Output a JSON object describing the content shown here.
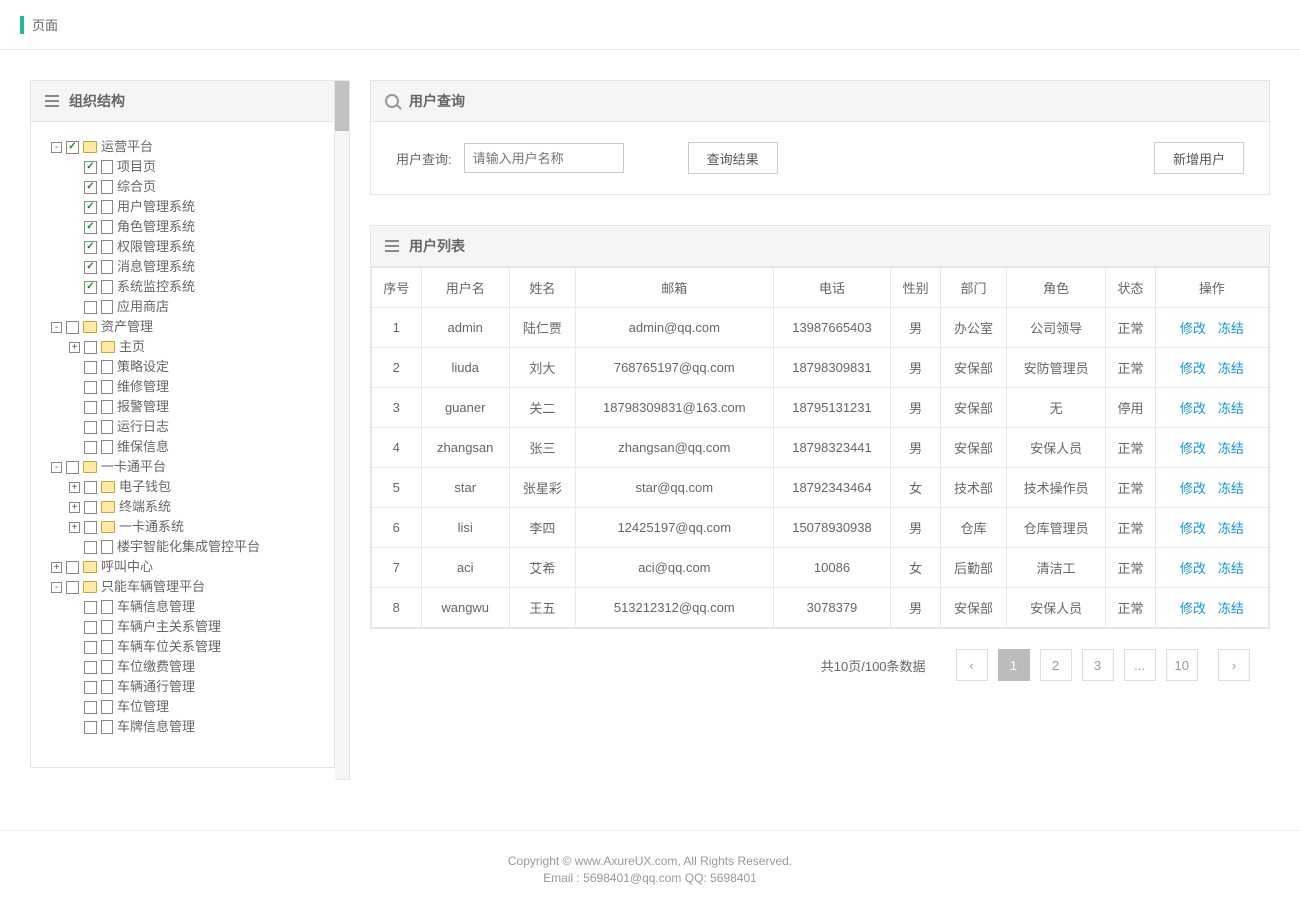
{
  "topbar": {
    "title": "页面"
  },
  "left": {
    "header": "组织结构",
    "tree": [
      {
        "label": "运营平台",
        "type": "folder",
        "toggle": "-",
        "checked": true,
        "children": [
          {
            "label": "项目页",
            "type": "page",
            "checked": true
          },
          {
            "label": "综合页",
            "type": "page",
            "checked": true
          },
          {
            "label": "用户管理系统",
            "type": "page",
            "checked": true
          },
          {
            "label": "角色管理系统",
            "type": "page",
            "checked": true
          },
          {
            "label": "权限管理系统",
            "type": "page",
            "checked": true
          },
          {
            "label": "消息管理系统",
            "type": "page",
            "checked": true
          },
          {
            "label": "系统监控系统",
            "type": "page",
            "checked": true
          },
          {
            "label": "应用商店",
            "type": "page",
            "checked": false
          }
        ]
      },
      {
        "label": "资产管理",
        "type": "folder",
        "toggle": "-",
        "checked": false,
        "children": [
          {
            "label": "主页",
            "type": "folder",
            "toggle": "+",
            "checked": false
          },
          {
            "label": "策略设定",
            "type": "page",
            "checked": false
          },
          {
            "label": "维修管理",
            "type": "page",
            "checked": false
          },
          {
            "label": "报警管理",
            "type": "page",
            "checked": false
          },
          {
            "label": "运行日志",
            "type": "page",
            "checked": false
          },
          {
            "label": "维保信息",
            "type": "page",
            "checked": false
          }
        ]
      },
      {
        "label": "一卡通平台",
        "type": "folder",
        "toggle": "-",
        "checked": false,
        "children": [
          {
            "label": "电子钱包",
            "type": "folder",
            "toggle": "+",
            "checked": false
          },
          {
            "label": "终端系统",
            "type": "folder",
            "toggle": "+",
            "checked": false
          },
          {
            "label": "一卡通系统",
            "type": "folder",
            "toggle": "+",
            "checked": false
          },
          {
            "label": "楼宇智能化集成管控平台",
            "type": "page",
            "checked": false
          }
        ]
      },
      {
        "label": "呼叫中心",
        "type": "folder",
        "toggle": "+",
        "checked": false
      },
      {
        "label": "只能车辆管理平台",
        "type": "folder",
        "toggle": "-",
        "checked": false,
        "children": [
          {
            "label": "车辆信息管理",
            "type": "page",
            "checked": false
          },
          {
            "label": "车辆户主关系管理",
            "type": "page",
            "checked": false
          },
          {
            "label": "车辆车位关系管理",
            "type": "page",
            "checked": false
          },
          {
            "label": "车位缴费管理",
            "type": "page",
            "checked": false
          },
          {
            "label": "车辆通行管理",
            "type": "page",
            "checked": false
          },
          {
            "label": "车位管理",
            "type": "page",
            "checked": false
          },
          {
            "label": "车牌信息管理",
            "type": "page",
            "checked": false
          }
        ]
      }
    ]
  },
  "search": {
    "header": "用户查询",
    "label": "用户查询:",
    "placeholder": "请输入用户名称",
    "query_btn": "查询结果",
    "add_btn": "新增用户"
  },
  "list": {
    "header": "用户列表",
    "columns": [
      "序号",
      "用户名",
      "姓名",
      "邮箱",
      "电话",
      "性别",
      "部门",
      "角色",
      "状态",
      "操作"
    ],
    "ops": {
      "edit": "修改",
      "freeze": "冻结"
    },
    "rows": [
      {
        "idx": "1",
        "user": "admin",
        "name": "陆仁贾",
        "email": "admin@qq.com",
        "phone": "13987665403",
        "sex": "男",
        "dept": "办公室",
        "role": "公司领导",
        "status": "正常"
      },
      {
        "idx": "2",
        "user": "liuda",
        "name": "刘大",
        "email": "768765197@qq.com",
        "phone": "18798309831",
        "sex": "男",
        "dept": "安保部",
        "role": "安防管理员",
        "status": "正常"
      },
      {
        "idx": "3",
        "user": "guaner",
        "name": "关二",
        "email": "18798309831@163.com",
        "phone": "18795131231",
        "sex": "男",
        "dept": "安保部",
        "role": "无",
        "status": "停用"
      },
      {
        "idx": "4",
        "user": "zhangsan",
        "name": "张三",
        "email": "zhangsan@qq.com",
        "phone": "18798323441",
        "sex": "男",
        "dept": "安保部",
        "role": "安保人员",
        "status": "正常"
      },
      {
        "idx": "5",
        "user": "star",
        "name": "张星彩",
        "email": "star@qq.com",
        "phone": "18792343464",
        "sex": "女",
        "dept": "技术部",
        "role": "技术操作员",
        "status": "正常"
      },
      {
        "idx": "6",
        "user": "lisi",
        "name": "李四",
        "email": "12425197@qq.com",
        "phone": "15078930938",
        "sex": "男",
        "dept": "仓库",
        "role": "仓库管理员",
        "status": "正常"
      },
      {
        "idx": "7",
        "user": "aci",
        "name": "艾希",
        "email": "aci@qq.com",
        "phone": "10086",
        "sex": "女",
        "dept": "后勤部",
        "role": "清洁工",
        "status": "正常"
      },
      {
        "idx": "8",
        "user": "wangwu",
        "name": "王五",
        "email": "513212312@qq.com",
        "phone": "3078379",
        "sex": "男",
        "dept": "安保部",
        "role": "安保人员",
        "status": "正常"
      }
    ]
  },
  "pager": {
    "info": "共10页/100条数据",
    "pages": [
      "1",
      "2",
      "3",
      "...",
      "10"
    ],
    "active": "1"
  },
  "footer": {
    "line1": "Copyright © www.AxureUX.com, All Rights Reserved.",
    "line2": "Email : 5698401@qq.com  QQ: 5698401"
  }
}
